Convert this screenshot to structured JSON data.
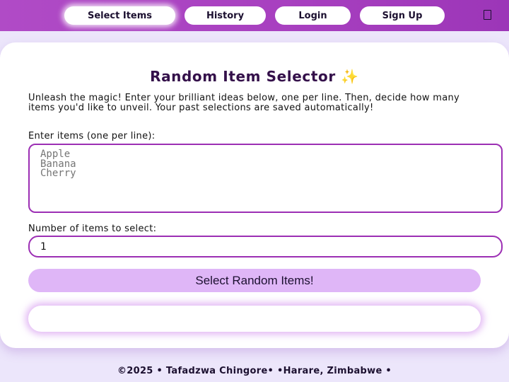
{
  "nav": {
    "items": [
      {
        "label": "Select Items"
      },
      {
        "label": "History"
      },
      {
        "label": "Login"
      },
      {
        "label": "Sign Up"
      }
    ],
    "active": "Select Items",
    "menu_icon": "menu-icon"
  },
  "main": {
    "title": "Random Item Selector ✨",
    "intro": "Unleash the magic! Enter your brilliant ideas below, one per line. Then, decide how many items you'd like to unveil. Your past selections are saved automatically!",
    "items_label": "Enter items (one per line):",
    "items_placeholder": "Apple\nBanana\nCherry",
    "count_label": "Number of items to select:",
    "count_value": "1",
    "select_button": "Select Random Items!"
  },
  "footer": {
    "text": "©2025 • Tafadzwa Chingore• •Harare, Zimbabwe •"
  },
  "colors": {
    "nav_background": "#a73fbf",
    "accent_border": "#9c2fb4",
    "button_fill": "#dfb6f7",
    "page_background": "#ece6fb"
  }
}
